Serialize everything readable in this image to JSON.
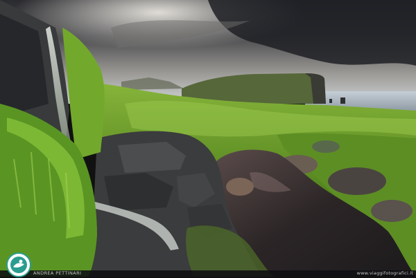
{
  "scene": {
    "subject": "waterfall-over-mossy-rocks-sea-cliff-landscape"
  },
  "watermark": {
    "credit": "ANDREA PETTINARI",
    "credit_secondary": "",
    "website": "www.viaggifotografici.it",
    "logo": "photographer-logo"
  },
  "colors": {
    "sky_dark": "#2c2d31",
    "sky_light": "#d8d5cf",
    "grass": "#6fa52a",
    "moss": "#4d7d1f",
    "rock": "#3a3c3d",
    "water": "#2a2627",
    "sea": "#aab6c0",
    "logo_accent": "#2a9d8f"
  }
}
